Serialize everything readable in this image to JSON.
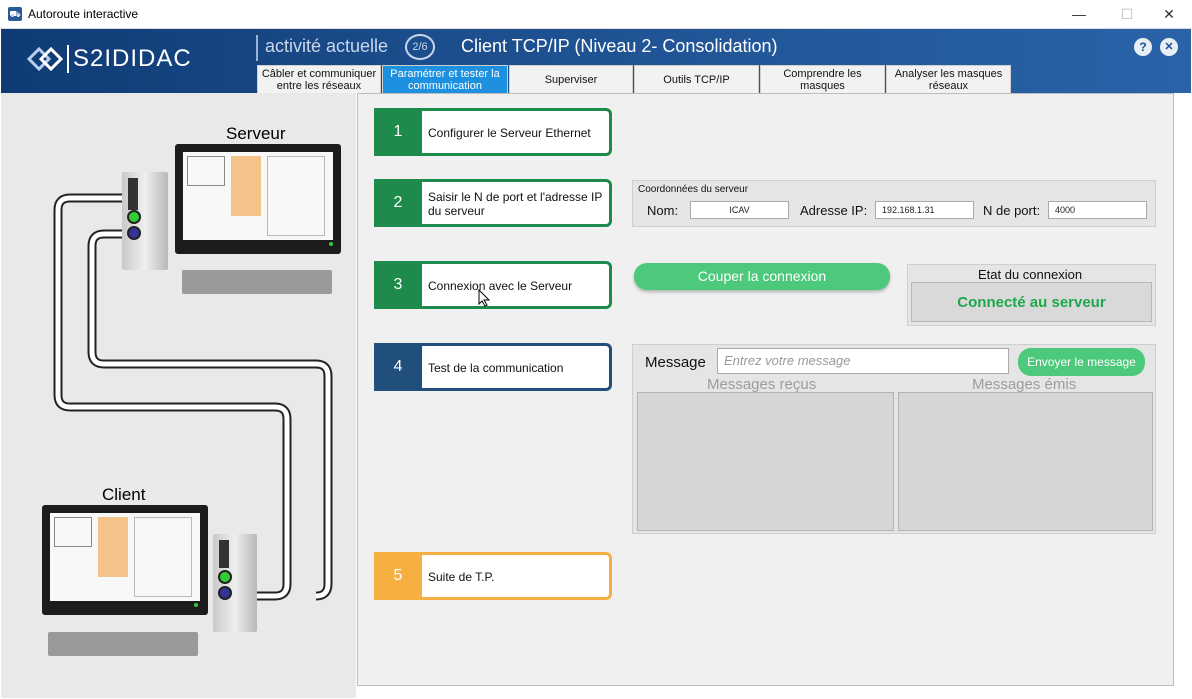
{
  "window": {
    "title": "Autoroute interactive",
    "minimize": "—",
    "maximize": "☐",
    "close": "✕"
  },
  "header": {
    "brand": "S2IDIDAC",
    "activity_label": "activité actuelle",
    "step_indicator": "2/6",
    "title": "Client TCP/IP (Niveau 2- Consolidation)",
    "help": "?",
    "close": "✕"
  },
  "tabs": [
    {
      "label": "Câbler et communiquer entre les réseaux"
    },
    {
      "label": "Paramétrer et tester la communication"
    },
    {
      "label": "Superviser"
    },
    {
      "label": "Outils TCP/IP"
    },
    {
      "label": "Comprendre les masques"
    },
    {
      "label": "Analyser les masques réseaux"
    }
  ],
  "diagram": {
    "server_label": "Serveur",
    "client_label": "Client"
  },
  "steps": [
    {
      "num": "1",
      "text": "Configurer le Serveur Ethernet"
    },
    {
      "num": "2",
      "text": "Saisir le N de port et l'adresse IP du serveur"
    },
    {
      "num": "3",
      "text": "Connexion avec le Serveur"
    },
    {
      "num": "4",
      "text": "Test de la communication"
    },
    {
      "num": "5",
      "text": "Suite de T.P."
    }
  ],
  "server_coords": {
    "title": "Coordonnées du serveur",
    "name_label": "Nom:",
    "name_value": "ICAV",
    "ip_label": "Adresse IP:",
    "ip_value": "192.168.1.31",
    "port_label": "N de port:",
    "port_value": "4000"
  },
  "connection": {
    "button": "Couper la connexion",
    "state_title": "Etat du connexion",
    "state_value": "Connecté au serveur"
  },
  "messaging": {
    "label": "Message",
    "placeholder": "Entrez votre message",
    "send_button": "Envoyer le message",
    "received_title": "Messages reçus",
    "sent_title": "Messages émis"
  },
  "colors": {
    "step_green": "#1e8a4c",
    "step_blue": "#1f4f7a",
    "step_orange": "#f6b042",
    "tab_active": "#1e90e0",
    "connect_green": "#4cc97a"
  }
}
